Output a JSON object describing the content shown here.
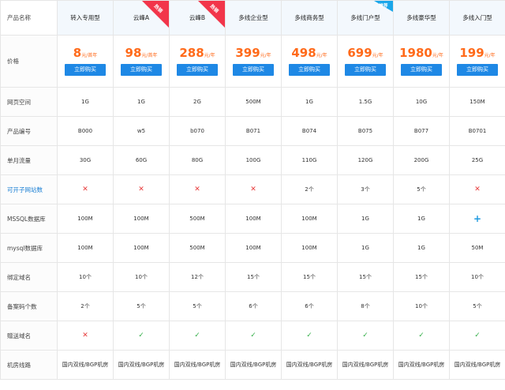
{
  "header": {
    "corner_label": "产品名称"
  },
  "plans": [
    {
      "name": "转入专用型",
      "price": "8",
      "unit": "元/首年",
      "ribbon": ""
    },
    {
      "name": "云峰A",
      "price": "98",
      "unit": "元/首年",
      "ribbon": "热销"
    },
    {
      "name": "云峰B",
      "price": "288",
      "unit": "元/年",
      "ribbon": "热销"
    },
    {
      "name": "多线企业型",
      "price": "399",
      "unit": "元/年",
      "ribbon": ""
    },
    {
      "name": "多线商务型",
      "price": "498",
      "unit": "元/年",
      "ribbon": ""
    },
    {
      "name": "多线门户型",
      "price": "699",
      "unit": "元/年",
      "ribbon": "推荐"
    },
    {
      "name": "多线豪华型",
      "price": "1980",
      "unit": "元/年",
      "ribbon": ""
    },
    {
      "name": "多线入门型",
      "price": "199",
      "unit": "元/年",
      "ribbon": ""
    }
  ],
  "buy_label": "立即购买",
  "price_row_label": "价格",
  "rows": [
    {
      "label": "网页空间",
      "values": [
        "1G",
        "1G",
        "2G",
        "500M",
        "1G",
        "1.5G",
        "10G",
        "150M"
      ]
    },
    {
      "label": "产品编号",
      "values": [
        "B000",
        "w5",
        "b070",
        "B071",
        "B074",
        "B075",
        "B077",
        "B0701"
      ]
    },
    {
      "label": "单月流量",
      "values": [
        "30G",
        "60G",
        "80G",
        "100G",
        "110G",
        "120G",
        "200G",
        "25G"
      ]
    },
    {
      "label": "可开子网站数",
      "highlight": true,
      "values": [
        "✕",
        "✕",
        "✕",
        "✕",
        "2个",
        "3个",
        "5个",
        "✕"
      ]
    },
    {
      "label": "MSSQL数据库",
      "values": [
        "100M",
        "100M",
        "500M",
        "100M",
        "100M",
        "1G",
        "1G",
        "+"
      ]
    },
    {
      "label": "mysql数据库",
      "values": [
        "100M",
        "100M",
        "500M",
        "100M",
        "100M",
        "1G",
        "1G",
        "50M"
      ]
    },
    {
      "label": "绑定域名",
      "values": [
        "10个",
        "10个",
        "12个",
        "15个",
        "15个",
        "15个",
        "15个",
        "10个"
      ]
    },
    {
      "label": "备案码个数",
      "values": [
        "2个",
        "5个",
        "5个",
        "6个",
        "6个",
        "8个",
        "10个",
        "5个"
      ]
    },
    {
      "label": "赠送域名",
      "values": [
        "✕",
        "✓",
        "✓",
        "✓",
        "✓",
        "✓",
        "✓",
        "✓"
      ]
    },
    {
      "label": "机房线路",
      "values": [
        "国内双线/BGP机房",
        "国内双线/BGP机房",
        "国内双线/BGP机房",
        "国内双线/BGP机房",
        "国内双线/BGP机房",
        "国内双线/BGP机房",
        "国内双线/BGP机房",
        "国内双线/BGP机房"
      ]
    }
  ],
  "colors": {
    "accent": "#1e88e5",
    "price": "#ff6a1a",
    "hot_ribbon": "#f2354a",
    "recommend_ribbon": "#1aa6ea",
    "cross": "#e83b3b",
    "check": "#36b04a"
  }
}
